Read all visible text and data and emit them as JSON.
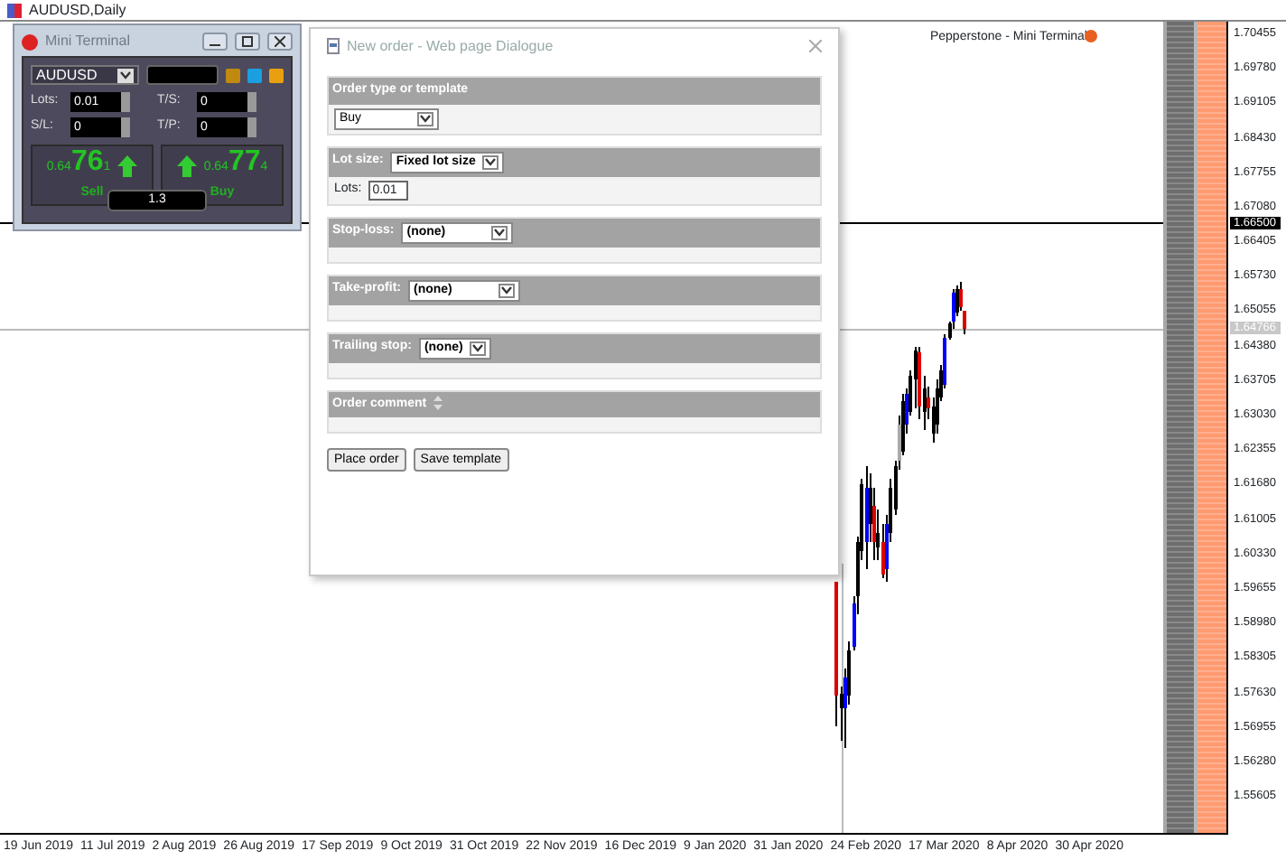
{
  "window": {
    "title": "AUDUSD,Daily"
  },
  "chart": {
    "expert_label": "Pepperstone - Mini Terminal"
  },
  "price_axis": {
    "ticks": [
      "1.70455",
      "1.69780",
      "1.69105",
      "1.68430",
      "1.67755",
      "1.67080",
      "1.66405",
      "1.65730",
      "1.65055",
      "1.64380",
      "1.63705",
      "1.63030",
      "1.62355",
      "1.61680",
      "1.61005",
      "1.60330",
      "1.59655",
      "1.58980",
      "1.58305",
      "1.57630",
      "1.56955",
      "1.56280",
      "1.55605"
    ],
    "line_label": "1.66500",
    "bid_label": "1.64766"
  },
  "time_axis": {
    "ticks": [
      "19 Jun 2019",
      "11 Jul 2019",
      "2 Aug 2019",
      "26 Aug 2019",
      "17 Sep 2019",
      "9 Oct 2019",
      "31 Oct 2019",
      "22 Nov 2019",
      "16 Dec 2019",
      "9 Jan 2020",
      "31 Jan 2020",
      "24 Feb 2020",
      "17 Mar 2020",
      "8 Apr 2020",
      "30 Apr 2020"
    ]
  },
  "mini_terminal": {
    "title": "Mini Terminal",
    "symbol": "AUDUSD",
    "fields": [
      {
        "label": "Lots:",
        "value": "0.01"
      },
      {
        "label": "T/S:",
        "value": "0"
      },
      {
        "label": "S/L:",
        "value": "0"
      },
      {
        "label": "T/P:",
        "value": "0"
      }
    ],
    "sell": {
      "label": "Sell",
      "price_head": "0.64",
      "price_big": "76",
      "price_tail": "1"
    },
    "buy": {
      "label": "Buy",
      "price_head": "0.64",
      "price_big": "77",
      "price_tail": "4"
    },
    "spread": "1.3"
  },
  "order_dialog": {
    "title": "New order - Web page Dialogue",
    "sections": [
      {
        "kind": "body-select",
        "label": "Order type or template",
        "select": "Buy"
      },
      {
        "kind": "lot",
        "label": "Lot size:",
        "select": "Fixed lot size",
        "field_label": "Lots:",
        "field_value": "0.01"
      },
      {
        "kind": "header-select",
        "label": "Stop-loss:",
        "select": "(none)"
      },
      {
        "kind": "header-select",
        "label": "Take-profit:",
        "select": "(none)"
      },
      {
        "kind": "header-select",
        "label": "Trailing stop:",
        "select": "(none)"
      },
      {
        "kind": "comment",
        "label": "Order comment"
      }
    ],
    "buttons": [
      "Place order",
      "Save template"
    ]
  }
}
